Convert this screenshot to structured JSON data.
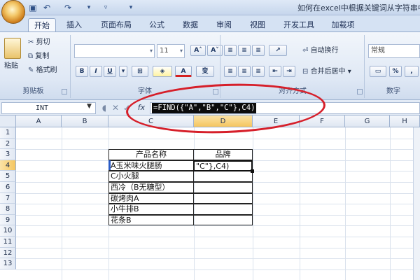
{
  "window": {
    "title": "如何在excel中根据关键词从字符串中"
  },
  "quick_access": {
    "icons": [
      "save-icon",
      "undo-icon",
      "redo-icon",
      "customize-icon"
    ]
  },
  "tabs": [
    {
      "label": "开始",
      "active": true
    },
    {
      "label": "插入",
      "active": false
    },
    {
      "label": "页面布局",
      "active": false
    },
    {
      "label": "公式",
      "active": false
    },
    {
      "label": "数据",
      "active": false
    },
    {
      "label": "审阅",
      "active": false
    },
    {
      "label": "视图",
      "active": false
    },
    {
      "label": "开发工具",
      "active": false
    },
    {
      "label": "加载项",
      "active": false
    }
  ],
  "ribbon": {
    "clipboard": {
      "paste_label": "粘贴",
      "cut_label": "剪切",
      "copy_label": "复制",
      "format_painter_label": "格式刷",
      "group_label": "剪贴板"
    },
    "font": {
      "font_size": "11",
      "group_label": "字体",
      "bold": "B",
      "italic": "I",
      "underline": "U",
      "grow": "A",
      "shrink": "A",
      "font_color": "A",
      "phonetic": "变"
    },
    "alignment": {
      "wrap_text_label": "自动换行",
      "merge_center_label": "合并后居中",
      "group_label": "对齐方式"
    },
    "number": {
      "format_value": "常规",
      "percent": "%",
      "group_label": "数字"
    }
  },
  "formula_bar": {
    "name_box": "INT",
    "cancel": "✕",
    "enter": "✓",
    "fx_label": "fx",
    "formula": "=FIND({\"A\",\"B\",\"C\"},C4)"
  },
  "sheet": {
    "columns": [
      "A",
      "B",
      "C",
      "D",
      "E",
      "F",
      "G",
      "H"
    ],
    "selected_column": "D",
    "rows": [
      "1",
      "2",
      "3",
      "4",
      "5",
      "6",
      "7",
      "8",
      "9",
      "10",
      "11",
      "12",
      "13"
    ],
    "selected_row": "4",
    "table": {
      "header_product": "产品名称",
      "header_brand": "品牌",
      "products": [
        "A玉米味火腿肠",
        "C小火腿",
        "西冷（B无糖型）",
        "碳烤肉A",
        "小牛排B",
        "花条B"
      ],
      "active_cell_text": "\"C\"},C4)"
    }
  }
}
